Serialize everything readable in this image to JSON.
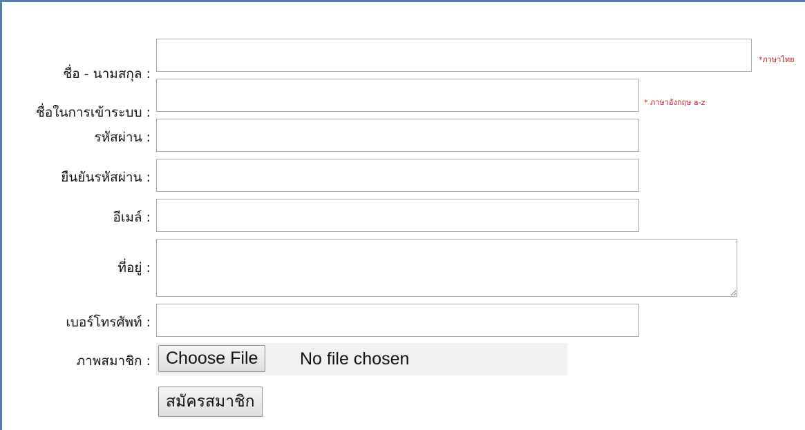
{
  "form": {
    "fullname": {
      "label": "ชื่อ - นามสกุล :",
      "value": "",
      "hint": "*ภาษาไทย"
    },
    "username": {
      "label": "ชื่อในการเข้าระบบ :",
      "value": "",
      "hint": "* ภาษาอังกฤษ a-z"
    },
    "password": {
      "label": "รหัสผ่าน :",
      "value": ""
    },
    "confirm_password": {
      "label": "ยืนยันรหัสผ่าน :",
      "value": ""
    },
    "email": {
      "label": "อีเมล์ :",
      "value": ""
    },
    "address": {
      "label": "ที่อยู่ :",
      "value": ""
    },
    "phone": {
      "label": "เบอร์โทรศัพท์ :",
      "value": ""
    },
    "photo": {
      "label": "ภาพสมาชิก :",
      "button_label": "Choose File",
      "status": "No file chosen"
    },
    "submit_label": "สมัครสมาชิก"
  },
  "colors": {
    "frame_border": "#4f7fb3",
    "hint_text": "#c0201a"
  }
}
